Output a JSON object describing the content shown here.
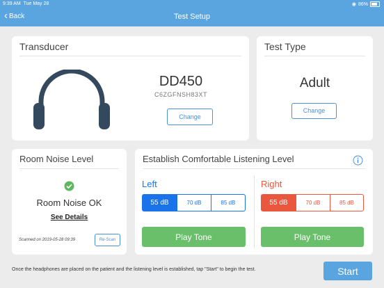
{
  "status_bar": {
    "time": "9:39 AM",
    "date": "Tue May 28",
    "battery": "86%"
  },
  "nav": {
    "back_label": "Back",
    "title": "Test Setup"
  },
  "transducer": {
    "title": "Transducer",
    "model": "DD450",
    "serial": "C6ZGFNSH83XT",
    "change_label": "Change",
    "icon": "headphones-icon"
  },
  "test_type": {
    "title": "Test Type",
    "value": "Adult",
    "change_label": "Change"
  },
  "room_noise": {
    "title": "Room Noise Level",
    "status": "Room Noise OK",
    "details_link": "See Details",
    "scanned_on": "Scanned on 2019-05-28 09:39",
    "rescan_label": "Re-Scan",
    "icon": "check-icon"
  },
  "listening": {
    "title": "Establish Comfortable Listening Level",
    "info_icon": "info-icon",
    "left": {
      "label": "Left",
      "levels": [
        "55 dB",
        "70 dB",
        "85 dB"
      ],
      "selected": "55 dB",
      "play_label": "Play Tone",
      "color": "#1a73e8"
    },
    "right": {
      "label": "Right",
      "levels": [
        "55 dB",
        "70 dB",
        "85 dB"
      ],
      "selected": "55 dB",
      "play_label": "Play Tone",
      "color": "#e9573f"
    }
  },
  "footer": {
    "instruction": "Once the headphones are placed on the patient and the listening level is established, tap \"Start\" to begin the test.",
    "start_label": "Start"
  },
  "colors": {
    "accent": "#5aa5df",
    "left": "#1a73e8",
    "right": "#e9573f",
    "play": "#6abf6a",
    "ok": "#5cb85c"
  }
}
